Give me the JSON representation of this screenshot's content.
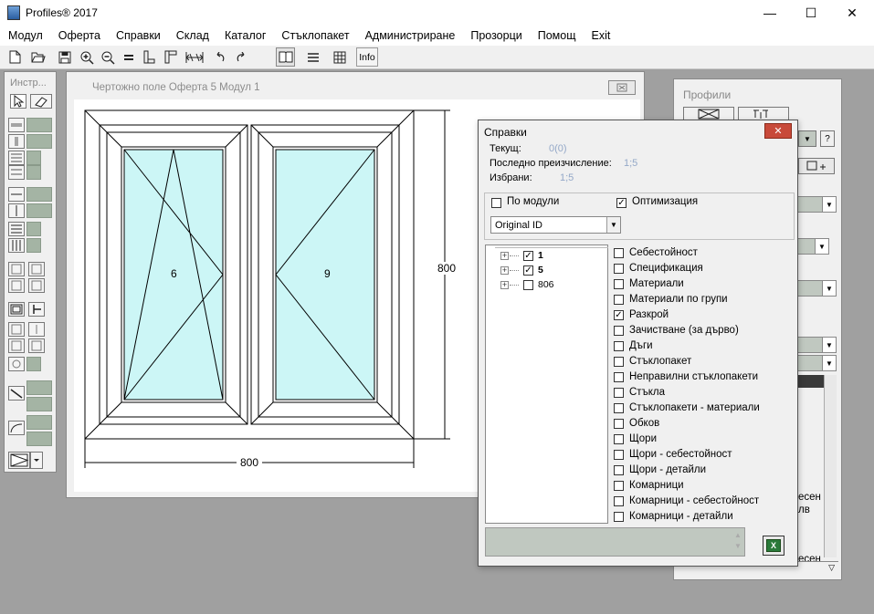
{
  "window": {
    "title": "Profiles® 2017",
    "controls": {
      "minimize": "—",
      "maximize": "☐",
      "close": "✕"
    }
  },
  "menu": [
    "Модул",
    "Оферта",
    "Справки",
    "Склад",
    "Каталог",
    "Стъклопакет",
    "Администриране",
    "Прозорци",
    "Помощ",
    "Exit"
  ],
  "toolbar": {
    "icons": [
      "new-icon",
      "open-icon",
      "save-icon",
      "zoom-in-icon",
      "zoom-out-icon",
      "equal-icon",
      "profile-icon",
      "profile2-icon",
      "dimension-icon",
      "undo-icon",
      "redo-icon",
      "book-view-icon",
      "list-view-icon",
      "grid-view-icon"
    ],
    "info_label": "Info"
  },
  "tools": {
    "caption": "Инстр..."
  },
  "drawing": {
    "caption": "Чертожно поле   Оферта  5   Модул  1",
    "sash_left_label": "6",
    "sash_right_label": "9",
    "height_dim": "800",
    "width_dim": "800"
  },
  "profiles_panel": {
    "caption": "Профили",
    "help_btn": "?",
    "frag1": "есен",
    "frag2": "лв",
    "frag3": "есен"
  },
  "reports": {
    "title": "Справки",
    "current_label": "Текущ:",
    "current_value": "0(0)",
    "last_recalc_label": "Последно преизчисление:",
    "last_recalc_value": "1;5",
    "selected_label": "Избрани:",
    "selected_value": "1;5",
    "by_modules_label": "По модули",
    "by_modules_checked": false,
    "optimization_label": "Оптимизация",
    "optimization_checked": true,
    "sort_select_value": "Original ID",
    "tree_items": [
      {
        "label": "1",
        "checked": true,
        "bold": true
      },
      {
        "label": "5",
        "checked": true,
        "bold": true
      },
      {
        "label": "806",
        "checked": false,
        "bold": false
      }
    ],
    "report_items": [
      {
        "label": "Себестойност",
        "checked": false
      },
      {
        "label": "Спецификация",
        "checked": false
      },
      {
        "label": "Материали",
        "checked": false
      },
      {
        "label": "Материали по групи",
        "checked": false
      },
      {
        "label": "Разкрой",
        "checked": true
      },
      {
        "label": "Зачистване (за дърво)",
        "checked": false
      },
      {
        "label": "Дъги",
        "checked": false
      },
      {
        "label": "Стъклопакет",
        "checked": false
      },
      {
        "label": "Неправилни стъклопакети",
        "checked": false
      },
      {
        "label": "Стъкла",
        "checked": false
      },
      {
        "label": "Стъклопакети - материали",
        "checked": false
      },
      {
        "label": "Обков",
        "checked": false
      },
      {
        "label": "Щори",
        "checked": false
      },
      {
        "label": "Щори - себестойност",
        "checked": false
      },
      {
        "label": "Щори - детайли",
        "checked": false
      },
      {
        "label": "Комарници",
        "checked": false
      },
      {
        "label": "Комарници - себестойност",
        "checked": false
      },
      {
        "label": "Комарници - детайли",
        "checked": false
      }
    ],
    "export_icon": "excel-export-icon",
    "export_label": "X"
  },
  "colors": {
    "glass": "#ccf6f6",
    "panel_fill": "#a4b4a4",
    "close_red": "#c84a3a"
  }
}
